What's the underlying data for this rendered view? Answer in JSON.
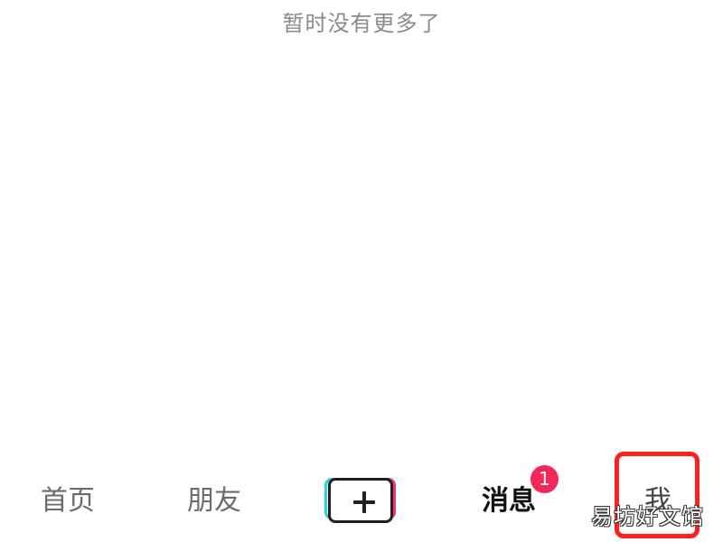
{
  "feed": {
    "end_message": "暂时没有更多了"
  },
  "tabbar": {
    "tabs": [
      {
        "label": "首页"
      },
      {
        "label": "朋友"
      },
      {
        "label": "消息"
      },
      {
        "label": "我"
      }
    ],
    "publish_icon": "plus-icon",
    "messages_badge": "1"
  },
  "watermark": "易坊好文馆",
  "colors": {
    "badge": "#f2275a",
    "highlight_border": "#ff1f1f",
    "accent_cyan": "#25d6de",
    "accent_red": "#f3346a"
  }
}
